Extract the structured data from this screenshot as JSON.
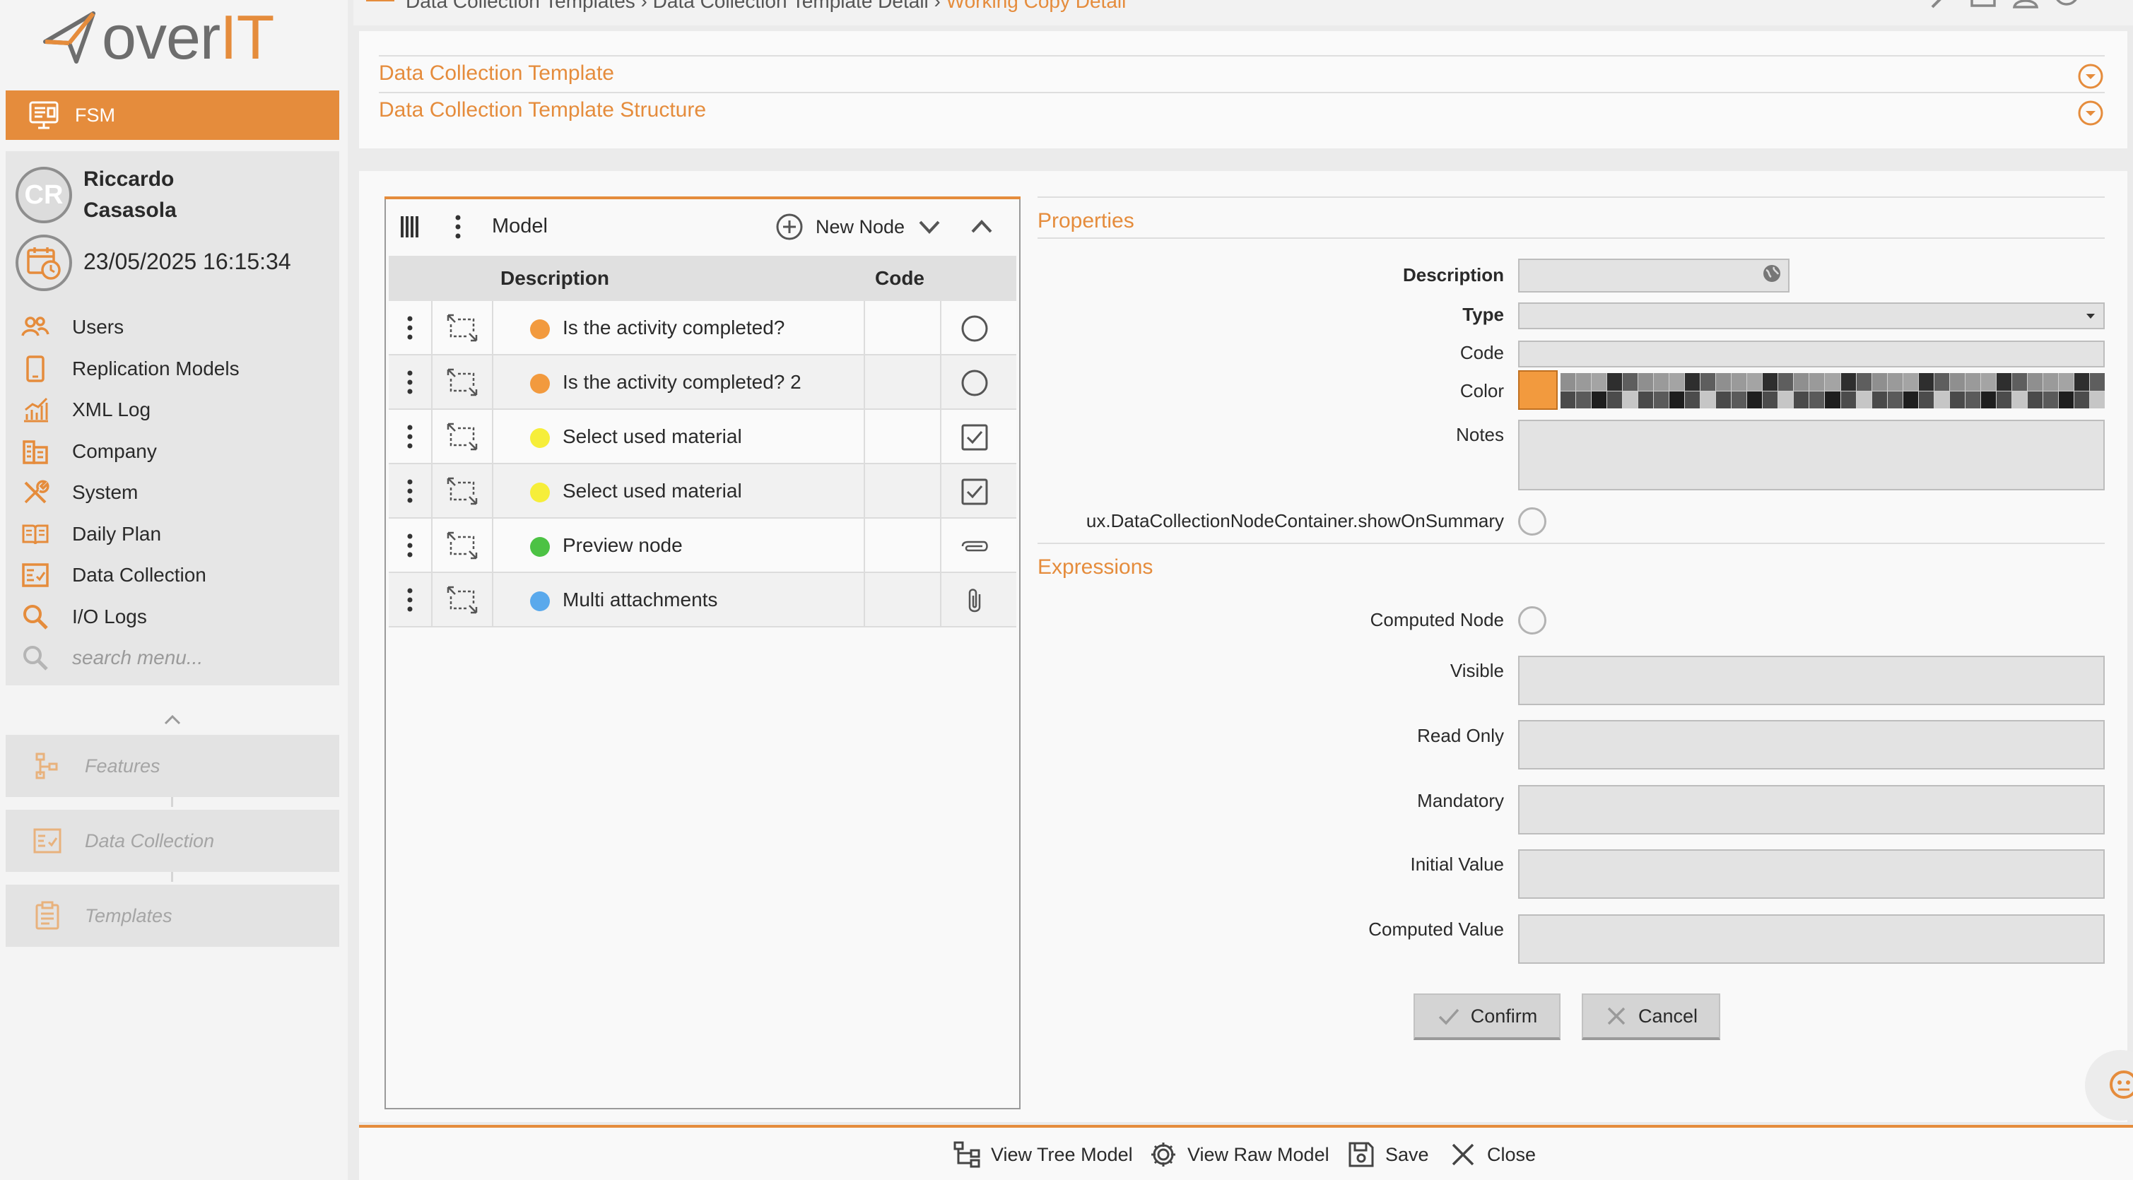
{
  "logo": {
    "text_main": "over",
    "text_accent": "IT"
  },
  "module": {
    "label": "FSM"
  },
  "user": {
    "initials": "CR",
    "name": "Riccardo Casasola",
    "datetime": "23/05/2025 16:15:34"
  },
  "nav": {
    "items": [
      {
        "label": "Users",
        "icon": "users-icon"
      },
      {
        "label": "Replication Models",
        "icon": "mobile-icon"
      },
      {
        "label": "XML Log",
        "icon": "chart-icon"
      },
      {
        "label": "Company",
        "icon": "company-icon"
      },
      {
        "label": "System",
        "icon": "tools-icon"
      },
      {
        "label": "Daily Plan",
        "icon": "book-icon"
      },
      {
        "label": "Data Collection",
        "icon": "checklist-icon"
      },
      {
        "label": "I/O Logs",
        "icon": "search-icon"
      }
    ],
    "search_placeholder": "search menu..."
  },
  "favorites": [
    {
      "label": "Features",
      "icon": "features-icon"
    },
    {
      "label": "Data Collection",
      "icon": "checklist-icon"
    },
    {
      "label": "Templates",
      "icon": "clipboard-icon"
    }
  ],
  "breadcrumb": {
    "parts": "Data Collection Templates › Data Collection Template Detail ›",
    "active": "Working Copy Detail"
  },
  "accordion": {
    "template": "Data Collection Template",
    "structure": "Data Collection Template Structure"
  },
  "model": {
    "title": "Model",
    "new_node": "New Node",
    "col_description": "Description",
    "col_code": "Code",
    "rows": [
      {
        "label": "Is the activity completed?",
        "color": "#f29a3e",
        "type": "radio-icon"
      },
      {
        "label": "Is the activity completed? 2",
        "color": "#f29a3e",
        "type": "radio-icon"
      },
      {
        "label": "Select used material",
        "color": "#f6ee3a",
        "type": "checkbox-icon"
      },
      {
        "label": "Select used material",
        "color": "#f6ee3a",
        "type": "checkbox-icon"
      },
      {
        "label": "Preview node",
        "color": "#4cc244",
        "type": "paperclip-icon"
      },
      {
        "label": "Multi attachments",
        "color": "#5aa9ec",
        "type": "paperclip-icon"
      }
    ]
  },
  "properties": {
    "title": "Properties",
    "description_label": "Description",
    "type_label": "Type",
    "code_label": "Code",
    "color_label": "Color",
    "color_value": "#f29a3e",
    "notes_label": "Notes",
    "show_on_summary_label": "ux.DataCollectionNodeContainer.showOnSummary"
  },
  "expressions": {
    "title": "Expressions",
    "computed_node_label": "Computed Node",
    "visible_label": "Visible",
    "read_only_label": "Read Only",
    "mandatory_label": "Mandatory",
    "initial_value_label": "Initial Value",
    "computed_value_label": "Computed Value"
  },
  "actions": {
    "confirm": "Confirm",
    "cancel": "Cancel"
  },
  "footer": {
    "view_tree": "View Tree Model",
    "view_raw": "View Raw Model",
    "save": "Save",
    "close": "Close"
  },
  "colors": {
    "accent": "#e58c3c"
  }
}
